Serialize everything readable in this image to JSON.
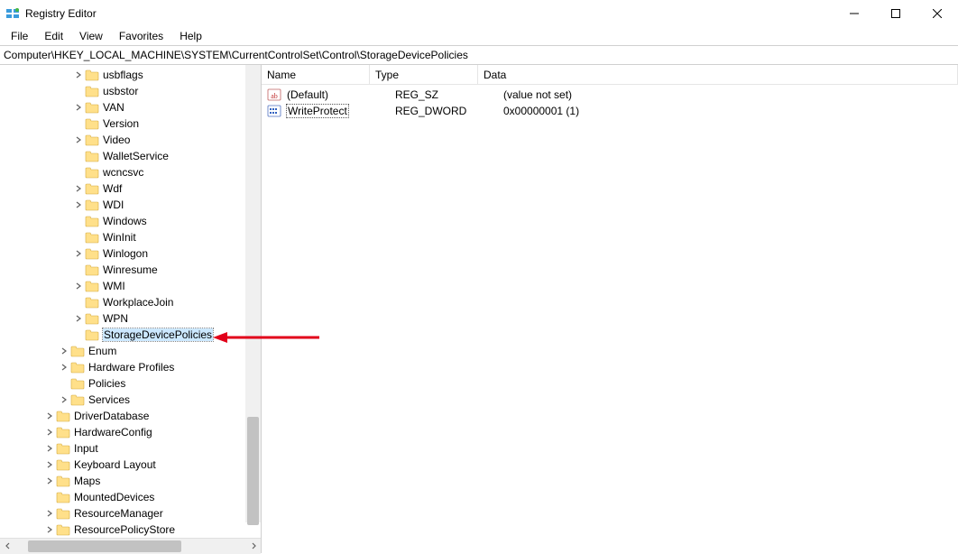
{
  "window": {
    "title": "Registry Editor"
  },
  "menu": {
    "file": "File",
    "edit": "Edit",
    "view": "View",
    "favorites": "Favorites",
    "help": "Help"
  },
  "address": "Computer\\HKEY_LOCAL_MACHINE\\SYSTEM\\CurrentControlSet\\Control\\StorageDevicePolicies",
  "tree": {
    "items": [
      {
        "label": "usbflags",
        "depth": 5,
        "expand": "closed"
      },
      {
        "label": "usbstor",
        "depth": 5,
        "expand": "none"
      },
      {
        "label": "VAN",
        "depth": 5,
        "expand": "closed"
      },
      {
        "label": "Version",
        "depth": 5,
        "expand": "none"
      },
      {
        "label": "Video",
        "depth": 5,
        "expand": "closed"
      },
      {
        "label": "WalletService",
        "depth": 5,
        "expand": "none"
      },
      {
        "label": "wcncsvc",
        "depth": 5,
        "expand": "none"
      },
      {
        "label": "Wdf",
        "depth": 5,
        "expand": "closed"
      },
      {
        "label": "WDI",
        "depth": 5,
        "expand": "closed"
      },
      {
        "label": "Windows",
        "depth": 5,
        "expand": "none"
      },
      {
        "label": "WinInit",
        "depth": 5,
        "expand": "none"
      },
      {
        "label": "Winlogon",
        "depth": 5,
        "expand": "closed"
      },
      {
        "label": "Winresume",
        "depth": 5,
        "expand": "none"
      },
      {
        "label": "WMI",
        "depth": 5,
        "expand": "closed"
      },
      {
        "label": "WorkplaceJoin",
        "depth": 5,
        "expand": "none"
      },
      {
        "label": "WPN",
        "depth": 5,
        "expand": "closed"
      },
      {
        "label": "StorageDevicePolicies",
        "depth": 5,
        "expand": "none",
        "selected": true
      },
      {
        "label": "Enum",
        "depth": 4,
        "expand": "closed"
      },
      {
        "label": "Hardware Profiles",
        "depth": 4,
        "expand": "closed"
      },
      {
        "label": "Policies",
        "depth": 4,
        "expand": "none"
      },
      {
        "label": "Services",
        "depth": 4,
        "expand": "closed"
      },
      {
        "label": "DriverDatabase",
        "depth": 3,
        "expand": "closed"
      },
      {
        "label": "HardwareConfig",
        "depth": 3,
        "expand": "closed"
      },
      {
        "label": "Input",
        "depth": 3,
        "expand": "closed"
      },
      {
        "label": "Keyboard Layout",
        "depth": 3,
        "expand": "closed"
      },
      {
        "label": "Maps",
        "depth": 3,
        "expand": "closed"
      },
      {
        "label": "MountedDevices",
        "depth": 3,
        "expand": "none"
      },
      {
        "label": "ResourceManager",
        "depth": 3,
        "expand": "closed"
      },
      {
        "label": "ResourcePolicyStore",
        "depth": 3,
        "expand": "closed"
      }
    ]
  },
  "list": {
    "headers": {
      "name": "Name",
      "type": "Type",
      "data": "Data"
    },
    "rows": [
      {
        "icon": "string",
        "name": "(Default)",
        "type": "REG_SZ",
        "data": "(value not set)",
        "selected": false
      },
      {
        "icon": "dword",
        "name": "WriteProtect",
        "type": "REG_DWORD",
        "data": "0x00000001 (1)",
        "selected": true
      }
    ]
  }
}
